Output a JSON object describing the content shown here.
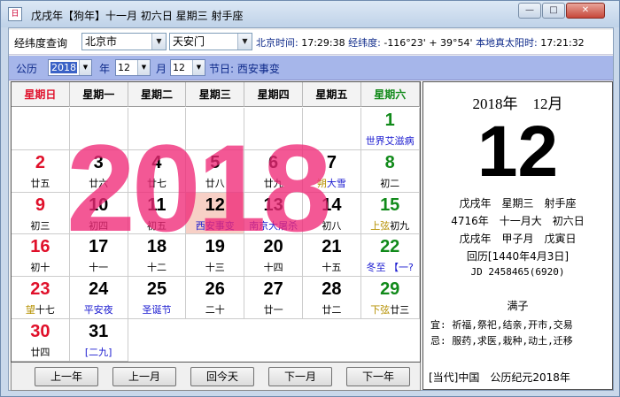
{
  "window": {
    "title": "戊戌年【狗年】十一月 初六日 星期三 射手座",
    "icon_text": "日",
    "min": "—",
    "max": "□",
    "close": "✕"
  },
  "location": {
    "label": "经纬度查询",
    "city": "北京市",
    "district": "天安门",
    "time_label": "北京时间:",
    "time_value": "17:29:38",
    "coord_label": "经纬度:",
    "coord_value": "-116°23' + 39°54'",
    "solar_label": "本地真太阳时:",
    "solar_value": "17:21:32"
  },
  "date_bar": {
    "calendar_label": "公历",
    "year": "2018",
    "year_unit": "年",
    "month": "12",
    "month_unit": "月",
    "day": "12",
    "holiday": "节日: 西安事变"
  },
  "weekdays": [
    "星期日",
    "星期一",
    "星期二",
    "星期三",
    "星期四",
    "星期五",
    "星期六"
  ],
  "watermark": "2018",
  "cells": [
    {
      "day": "",
      "lunar": ""
    },
    {
      "day": "",
      "lunar": ""
    },
    {
      "day": "",
      "lunar": ""
    },
    {
      "day": "",
      "lunar": ""
    },
    {
      "day": "",
      "lunar": ""
    },
    {
      "day": "",
      "lunar": ""
    },
    {
      "day": "1",
      "lunar": "世界艾滋病"
    },
    {
      "day": "2",
      "lunar": "廿五"
    },
    {
      "day": "3",
      "lunar": "廿六"
    },
    {
      "day": "4",
      "lunar": "廿七"
    },
    {
      "day": "5",
      "lunar": "廿八"
    },
    {
      "day": "6",
      "lunar": "廿九"
    },
    {
      "day": "7",
      "lunar": "大雪"
    },
    {
      "day": "8",
      "lunar": "初二"
    },
    {
      "day": "9",
      "lunar": "初三"
    },
    {
      "day": "10",
      "lunar": "初四"
    },
    {
      "day": "11",
      "lunar": "初五"
    },
    {
      "day": "12",
      "lunar": "西安事变"
    },
    {
      "day": "13",
      "lunar": "南京大屠杀"
    },
    {
      "day": "14",
      "lunar": "初八"
    },
    {
      "day": "15",
      "lunar": "初九"
    },
    {
      "day": "16",
      "lunar": "初十"
    },
    {
      "day": "17",
      "lunar": "十一"
    },
    {
      "day": "18",
      "lunar": "十二"
    },
    {
      "day": "19",
      "lunar": "十三"
    },
    {
      "day": "20",
      "lunar": "十四"
    },
    {
      "day": "21",
      "lunar": "十五"
    },
    {
      "day": "22",
      "lunar": "冬至 【一?"
    },
    {
      "day": "23",
      "lunar": "十七"
    },
    {
      "day": "24",
      "lunar": "平安夜"
    },
    {
      "day": "25",
      "lunar": "圣诞节"
    },
    {
      "day": "26",
      "lunar": "二十"
    },
    {
      "day": "27",
      "lunar": "廿一"
    },
    {
      "day": "28",
      "lunar": "廿二"
    },
    {
      "day": "29",
      "lunar": "廿三"
    },
    {
      "day": "30",
      "lunar": "廿四"
    },
    {
      "day": "31",
      "lunar": "[二九]"
    }
  ],
  "markers": {
    "d7": "朔",
    "d15": "上弦",
    "d23": "望",
    "d29": "下弦"
  },
  "nav": [
    "上一年",
    "上一月",
    "回今天",
    "下一月",
    "下一年"
  ],
  "panel": {
    "year_month": "2018年　12月",
    "big_day": "12",
    "line1": "戊戌年　星期三　射手座",
    "line2": "4716年　十一月大　初六日",
    "line3": "戊戌年　甲子月　戊寅日",
    "line4": "回历[1440年4月3日]",
    "line5": "JD 2458465(6920)",
    "deity": "满子",
    "yi": "宜: 祈福,祭祀,结亲,开市,交易",
    "ji": "忌: 服药,求医,栽种,动土,迁移",
    "era": "[当代]中国　公历纪元2018年"
  },
  "colors": {
    "sunday": "#e0102a",
    "saturday": "#118a1a",
    "festival": "#1a1ad0",
    "today_bg": "#f7d0c6",
    "watermark": "#f02a78"
  }
}
